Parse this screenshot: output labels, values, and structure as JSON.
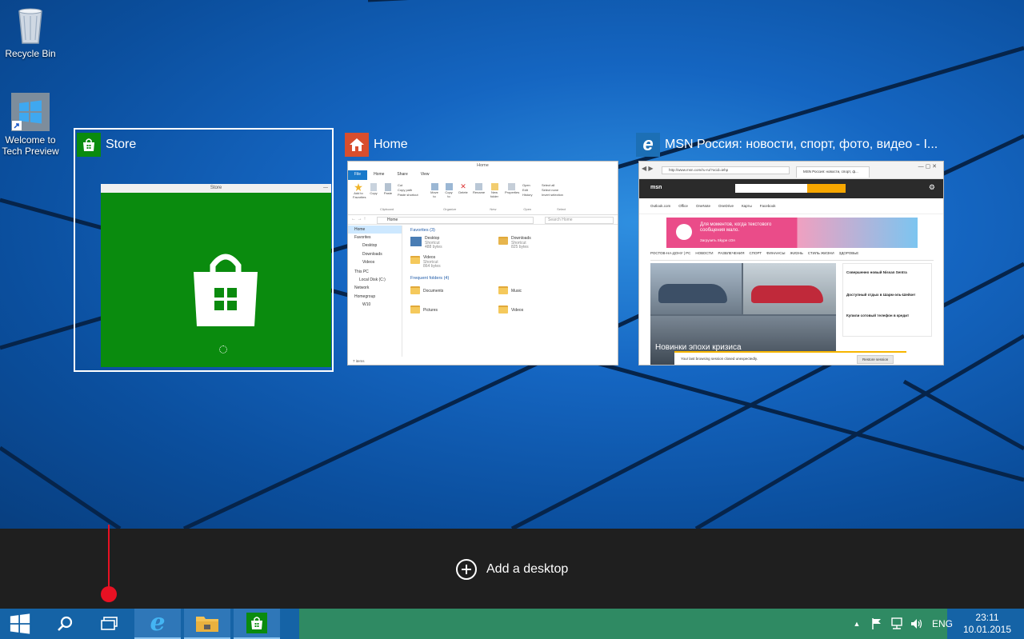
{
  "desktop": {
    "icons": [
      {
        "label": "Recycle Bin",
        "icon": "recycle-bin-icon"
      },
      {
        "label": "Welcome to Tech Preview",
        "icon": "windows-shortcut-icon"
      }
    ]
  },
  "task_view": {
    "windows": [
      {
        "title": "Store",
        "icon": "store-icon",
        "accent": "#0a8b0e",
        "selected": true,
        "app_title": "Store"
      },
      {
        "title": "Home",
        "icon": "file-explorer-icon",
        "accent": "#d84e2e",
        "selected": false
      },
      {
        "title": "MSN Россия: новости, спорт, фото, видео - I...",
        "icon": "internet-explorer-icon",
        "accent": "#1c6fb5",
        "selected": false
      }
    ],
    "explorer": {
      "title": "Home",
      "tabs": [
        "File",
        "Home",
        "Share",
        "View"
      ],
      "ribbon_groups": [
        "Clipboard",
        "Organize",
        "New",
        "Open",
        "Select"
      ],
      "ribbon_items": [
        "Add to Favorites",
        "Copy",
        "Paste",
        "Cut",
        "Copy path",
        "Paste shortcut",
        "Move to",
        "Copy to",
        "Delete",
        "Rename",
        "New folder",
        "Properties",
        "Open",
        "Edit",
        "History",
        "Select all",
        "Select none",
        "Invert selection"
      ],
      "address": "Home",
      "search_placeholder": "Search Home",
      "sidebar": [
        "Home",
        "Favorites",
        "Desktop",
        "Downloads",
        "Videos",
        "This PC",
        "Local Disk (C:)",
        "Network",
        "Homegroup",
        "W10"
      ],
      "favorites_header": "Favorites (3)",
      "favorites": [
        {
          "name": "Desktop",
          "sub1": "Shortcut",
          "sub2": "488 bytes"
        },
        {
          "name": "Downloads",
          "sub1": "Shortcut",
          "sub2": "825 bytes"
        },
        {
          "name": "Videos",
          "sub1": "Shortcut",
          "sub2": "864 bytes"
        }
      ],
      "frequent_header": "Frequent folders (4)",
      "frequent": [
        "Documents",
        "Music",
        "Pictures",
        "Videos"
      ],
      "status": "7 items"
    },
    "browser": {
      "url": "http://www.msn.com/ru-ru/?ocid=iehp",
      "tab": "MSN Россия: новости, спорт, ф...",
      "brand": "msn",
      "links": [
        "Outlook.com",
        "Office",
        "OneNote",
        "OneDrive",
        "Карты",
        "Facebook"
      ],
      "ad_text": "Для моментов, когда текстового сообщения мало.",
      "ad_sub": "Загрузить Skype сОя",
      "nav": [
        "РОСТОВ-НА-ДОНУ | РС",
        "НОВОСТИ",
        "РАЗВЛЕЧЕНИЯ",
        "СПОРТ",
        "ФИНАНСЫ",
        "ЖИЗНЬ",
        "СТИЛЬ ЖИЗНИ",
        "ЗДОРОВЬЕ"
      ],
      "headline": "Новинки эпохи кризиса",
      "side_news": [
        "Совершенно новый Nissan Sentra",
        "Доступный отдых в Шарм-эль-Шейхе!",
        "Купили сотовый телефон в кредит"
      ],
      "notification": "Your last browsing session closed unexpectedly.",
      "restore_label": "Restore session"
    }
  },
  "bar": {
    "add_desktop_label": "Add a desktop"
  },
  "taskbar": {
    "buttons": [
      {
        "name": "start-button",
        "icon": "windows-logo-icon"
      },
      {
        "name": "search-button",
        "icon": "search-icon"
      },
      {
        "name": "task-view-button",
        "icon": "task-view-icon"
      },
      {
        "name": "internet-explorer-button",
        "icon": "internet-explorer-icon"
      },
      {
        "name": "file-explorer-button",
        "icon": "file-explorer-icon"
      },
      {
        "name": "store-button",
        "icon": "store-icon"
      }
    ],
    "tray_icons": [
      "chevron-up-icon",
      "flag-icon",
      "network-icon",
      "volume-icon"
    ],
    "language": "ENG",
    "time": "23:11",
    "date": "10.01.2015"
  },
  "colors": {
    "store_green": "#0a8b0e",
    "taskbar_blue": "#1563a6",
    "bar_dark": "#1f1f1f",
    "pointer_red": "#e81123"
  }
}
